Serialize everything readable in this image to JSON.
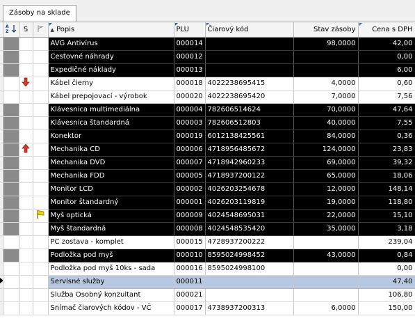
{
  "tab": {
    "label": "Zásoby na sklade"
  },
  "columns": {
    "sort": "A Z",
    "s": "S",
    "popis": "Popis",
    "plu": "PLU",
    "barcode": "Čiarový kód",
    "stav": "Stav zásoby",
    "cena": "Cena s DPH"
  },
  "rows": [
    {
      "popis": "AVG Antivírus",
      "plu": "000014",
      "barcode": "",
      "stav": "98,0000",
      "cena": "42,00",
      "dark": true,
      "marker": "",
      "flag": ""
    },
    {
      "popis": "Cestovné náhrady",
      "plu": "000012",
      "barcode": "",
      "stav": "",
      "cena": "0,00",
      "dark": true,
      "marker": "",
      "flag": ""
    },
    {
      "popis": "Expedičné náklady",
      "plu": "000013",
      "barcode": "",
      "stav": "",
      "cena": "6,00",
      "dark": true,
      "marker": "",
      "flag": ""
    },
    {
      "popis": "Kábel čierny",
      "plu": "000018",
      "barcode": "4022238695415",
      "stav": "4,0000",
      "cena": "0,60",
      "dark": false,
      "marker": "down",
      "flag": ""
    },
    {
      "popis": "Kábel prepojovací - výrobok",
      "plu": "000020",
      "barcode": "4022238695420",
      "stav": "7,0000",
      "cena": "7,56",
      "dark": false,
      "marker": "",
      "flag": ""
    },
    {
      "popis": "Klávesnica multimediálna",
      "plu": "000004",
      "barcode": "782606514624",
      "stav": "70,0000",
      "cena": "47,64",
      "dark": true,
      "marker": "",
      "flag": ""
    },
    {
      "popis": "Klávesnica štandardná",
      "plu": "000003",
      "barcode": "782606512803",
      "stav": "40,0000",
      "cena": "7,55",
      "dark": true,
      "marker": "",
      "flag": ""
    },
    {
      "popis": "Konektor",
      "plu": "000019",
      "barcode": "6012138425561",
      "stav": "84,0000",
      "cena": "0,36",
      "dark": true,
      "marker": "",
      "flag": ""
    },
    {
      "popis": "Mechanika CD",
      "plu": "000006",
      "barcode": "4718956485672",
      "stav": "124,0000",
      "cena": "23,83",
      "dark": true,
      "marker": "up",
      "flag": ""
    },
    {
      "popis": "Mechanika DVD",
      "plu": "000007",
      "barcode": "4718942960233",
      "stav": "69,0000",
      "cena": "39,32",
      "dark": true,
      "marker": "",
      "flag": ""
    },
    {
      "popis": "Mechanika FDD",
      "plu": "000005",
      "barcode": "4718937200122",
      "stav": "65,0000",
      "cena": "18,06",
      "dark": true,
      "marker": "",
      "flag": ""
    },
    {
      "popis": "Monitor LCD",
      "plu": "000002",
      "barcode": "4026203254678",
      "stav": "12,0000",
      "cena": "148,14",
      "dark": true,
      "marker": "",
      "flag": ""
    },
    {
      "popis": "Monitor štandardný",
      "plu": "000001",
      "barcode": "4026203119819",
      "stav": "19,0000",
      "cena": "118,80",
      "dark": true,
      "marker": "",
      "flag": ""
    },
    {
      "popis": "Myš optická",
      "plu": "000009",
      "barcode": "4024548695031",
      "stav": "22,0000",
      "cena": "15,10",
      "dark": true,
      "marker": "",
      "flag": "yellow"
    },
    {
      "popis": "Myš štandardná",
      "plu": "000008",
      "barcode": "4024548535420",
      "stav": "35,0000",
      "cena": "3,18",
      "dark": true,
      "marker": "",
      "flag": ""
    },
    {
      "popis": "PC zostava - komplet",
      "plu": "000015",
      "barcode": "4728937200222",
      "stav": "",
      "cena": "239,04",
      "dark": false,
      "marker": "",
      "flag": ""
    },
    {
      "popis": "Podložka pod myš",
      "plu": "000010",
      "barcode": "8595024998452",
      "stav": "43,0000",
      "cena": "0,84",
      "dark": true,
      "marker": "",
      "flag": ""
    },
    {
      "popis": "Podložka pod myš 10ks - sada",
      "plu": "000016",
      "barcode": "8595024998100",
      "stav": "",
      "cena": "0,00",
      "dark": false,
      "marker": "",
      "flag": ""
    },
    {
      "popis": "Servisné služby",
      "plu": "000011",
      "barcode": "",
      "stav": "",
      "cena": "47,40",
      "dark": false,
      "marker": "",
      "flag": "",
      "selected": true
    },
    {
      "popis": "Služba Osobný konzultant",
      "plu": "000021",
      "barcode": "",
      "stav": "",
      "cena": "106,80",
      "dark": false,
      "marker": "",
      "flag": ""
    },
    {
      "popis": "Snímač čiarových kódov - VČ",
      "plu": "000017",
      "barcode": "4738937200313",
      "stav": "6,0000",
      "cena": "150,00",
      "dark": false,
      "marker": "",
      "flag": ""
    }
  ]
}
